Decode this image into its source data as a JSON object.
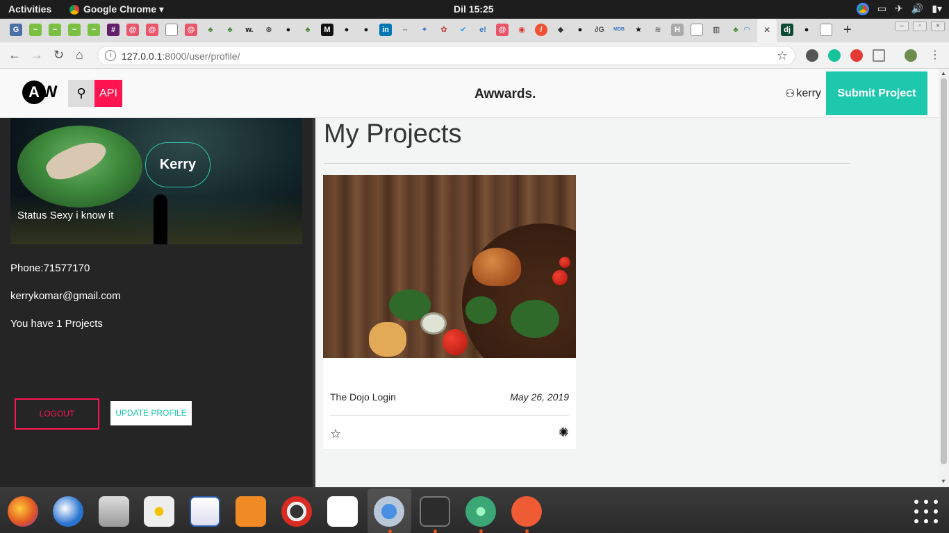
{
  "topbar": {
    "activities": "Activities",
    "app_name": "Google Chrome ▾",
    "clock": "Dil 15:25"
  },
  "browser": {
    "url_host": "127.0.0.1",
    "url_path": ":8000/user/profile/",
    "active_tab_close": "×",
    "new_tab": "+"
  },
  "site": {
    "logo_letter": "A",
    "logo_w": "W",
    "api_label": "API",
    "brand": "Awwards.",
    "username": "kerry",
    "submit_label": "Submit Project"
  },
  "profile": {
    "name": "Kerry",
    "status": "Status Sexy i know it",
    "phone": "Phone:71577170",
    "email": "kerrykomar@gmail.com",
    "projects_count": "You have 1 Projects",
    "logout_label": "LOGOUT",
    "update_label": "UPDATE PROFILE"
  },
  "main": {
    "title": "My Projects",
    "projects": [
      {
        "title": "The Dojo Login",
        "date": "May 26, 2019"
      }
    ]
  },
  "colors": {
    "accent": "#1ec8ad",
    "danger": "#ff1452",
    "sidebar": "#252525"
  },
  "icons": [
    "search-icon",
    "user-icon",
    "star-icon",
    "bug-icon",
    "back-icon",
    "forward-icon",
    "reload-icon",
    "home-icon",
    "bookmark-star-icon"
  ]
}
